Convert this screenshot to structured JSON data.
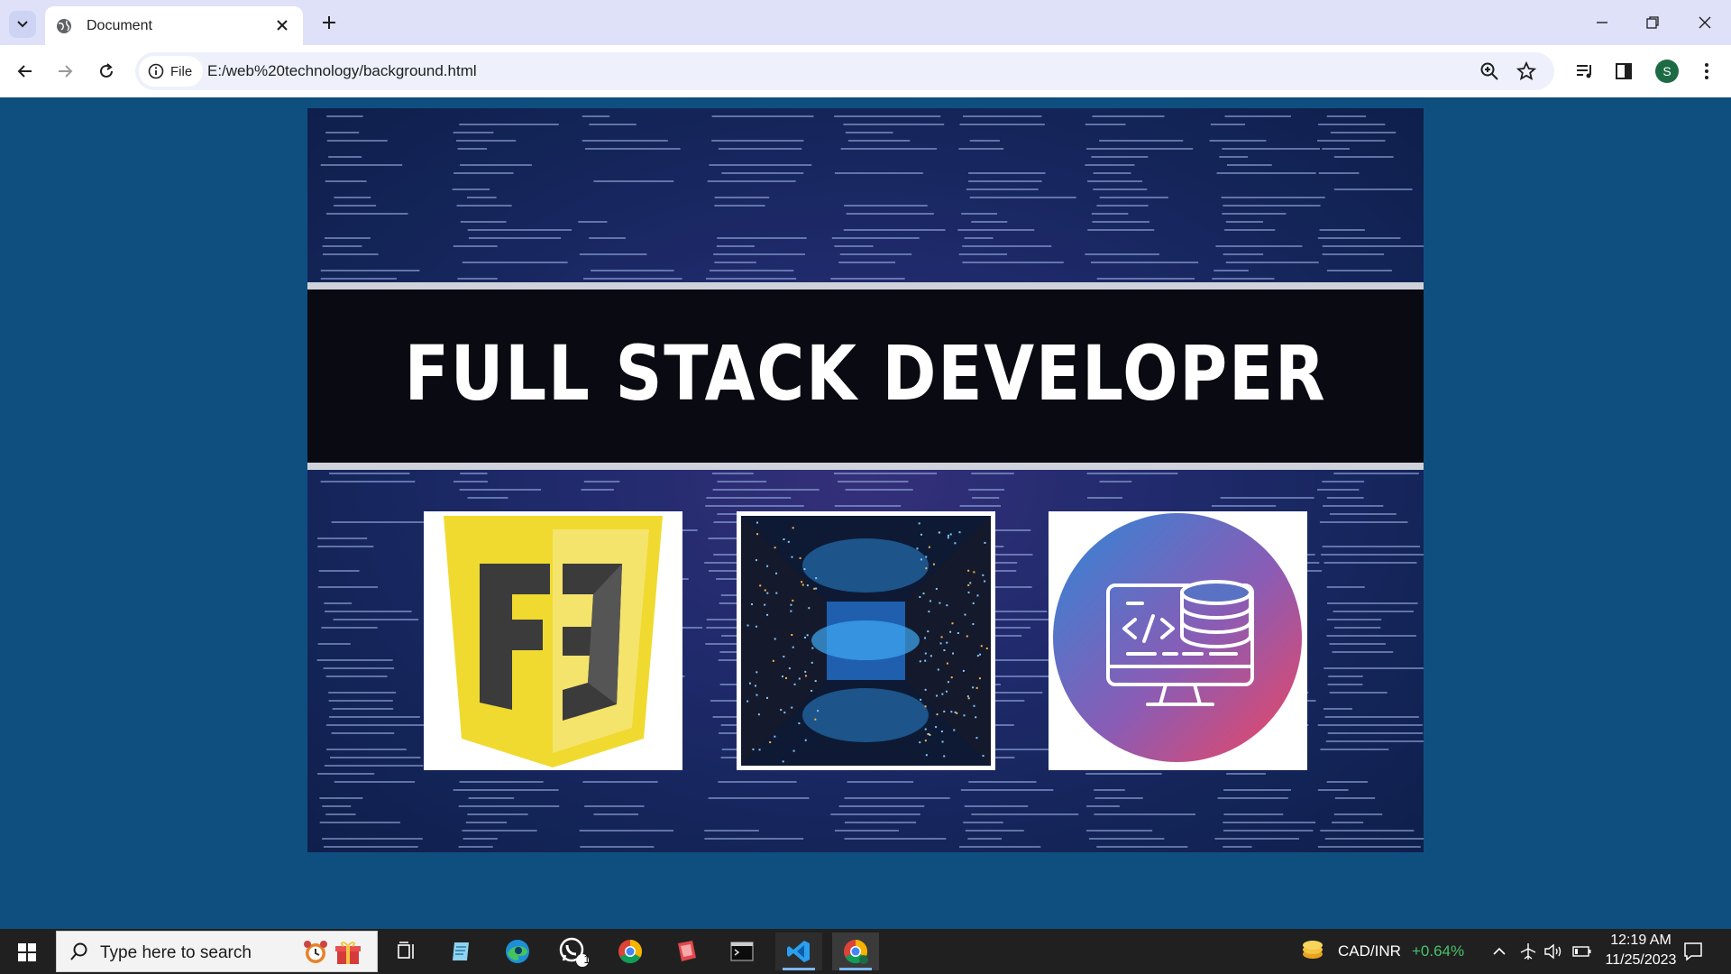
{
  "browser": {
    "tab_title": "Document",
    "scheme_chip": "File",
    "url": "E:/web%20technology/background.html",
    "profile_initial": "S"
  },
  "page": {
    "headline": "FULL STACK DEVELOPER",
    "cards": [
      {
        "icon": "css-framework-shield-icon",
        "colors": [
          "#f0da30",
          "#3b3b3b"
        ]
      },
      {
        "icon": "server-room-image",
        "colors": [
          "#3fa9f5",
          "#0b1020"
        ]
      },
      {
        "icon": "web-database-monitor-icon",
        "colors": [
          "#2f86d6",
          "#f0445f"
        ]
      }
    ],
    "background_color": "#0f4f80"
  },
  "taskbar": {
    "search_placeholder": "Type here to search",
    "currency_pair": "CAD/INR",
    "currency_change": "+0.64%",
    "time": "12:19 AM",
    "date": "11/25/2023",
    "whatsapp_badge": "1"
  }
}
